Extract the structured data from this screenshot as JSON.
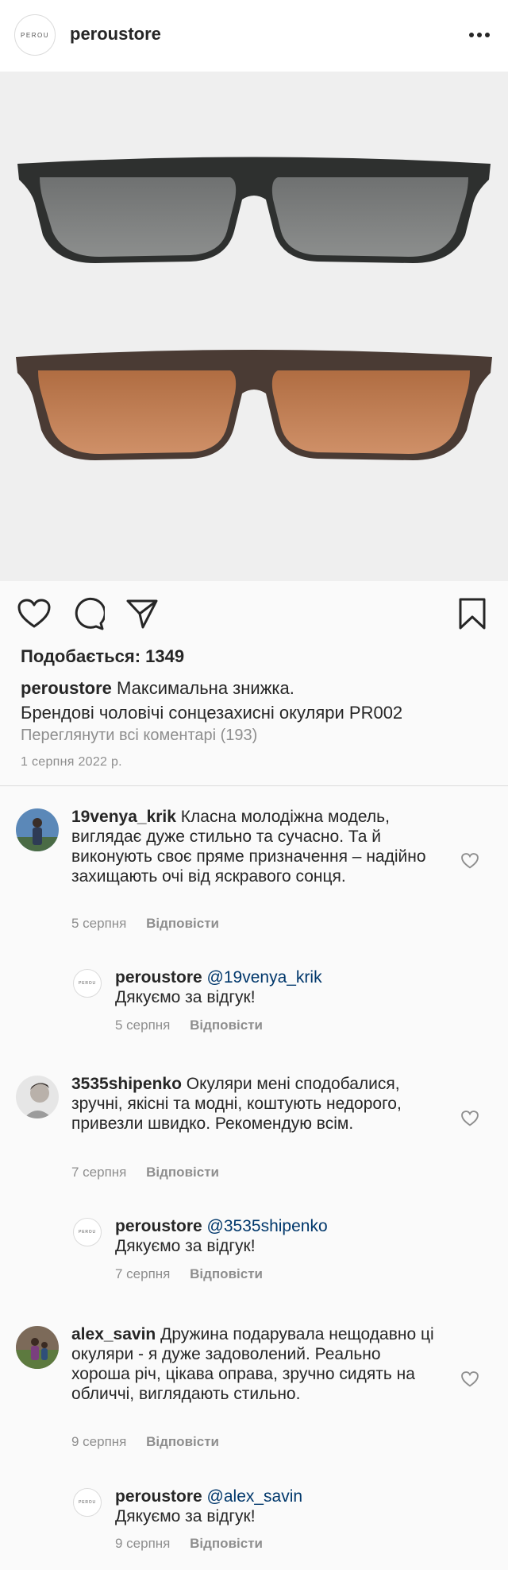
{
  "header": {
    "logo_text": "PEROU",
    "username": "peroustore"
  },
  "post": {
    "likes_label": "Подобається: 1349",
    "caption_user": "peroustore",
    "caption_line1": "Максимальна знижка.",
    "caption_line2": "Брендові чоловічі сонцезахисні окуляри PR002",
    "view_all_comments": "Переглянути всі коментарі (193)",
    "date": "1 серпня 2022 р."
  },
  "comments": [
    {
      "user": "19venya_krik",
      "text": "Класна молодіжна модель, виглядає дуже стильно та сучасно. Та й виконують своє пряме призначення – надійно захищають очі від яскравого сонця.",
      "date": "5 серпня",
      "reply_label": "Відповісти",
      "reply": {
        "user": "peroustore",
        "logo_text": "PEROU",
        "mention": "@19venya_krik",
        "text": "Дякуємо за відгук!",
        "date": "5 серпня",
        "reply_label": "Відповісти"
      }
    },
    {
      "user": "3535shipenko",
      "text": "Окуляри мені сподобалися, зручні, якісні та модні, коштують недорого, привезли швидко. Рекомендую всім.",
      "date": "7 серпня",
      "reply_label": "Відповісти",
      "reply": {
        "user": "peroustore",
        "logo_text": "PEROU",
        "mention": "@3535shipenko",
        "text": "Дякуємо за відгук!",
        "date": "7 серпня",
        "reply_label": "Відповісти"
      }
    },
    {
      "user": "alex_savin",
      "text": "Дружина подарувала нещодавно ці окуляри - я дуже задоволений. Реально хороша річ, цікава оправа, зручно сидять на обличчі, виглядають стильно.",
      "date": "9 серпня",
      "reply_label": "Відповісти",
      "reply": {
        "user": "peroustore",
        "logo_text": "PEROU",
        "mention": "@alex_savin",
        "text": "Дякуємо за відгук!",
        "date": "9 серпня",
        "reply_label": "Відповісти"
      }
    }
  ],
  "icons": {
    "more": "more-horizontal-icon",
    "like": "heart-icon",
    "comment": "comment-bubble-icon",
    "share": "paper-plane-icon",
    "save": "bookmark-icon",
    "comment_like": "small-heart-icon"
  },
  "colors": {
    "background": "#fafafa",
    "text": "#262626",
    "secondary": "#8e8e8e",
    "mention": "#00376b",
    "lens_grey": "#7b7d7d",
    "lens_brown": "#c07e52"
  }
}
